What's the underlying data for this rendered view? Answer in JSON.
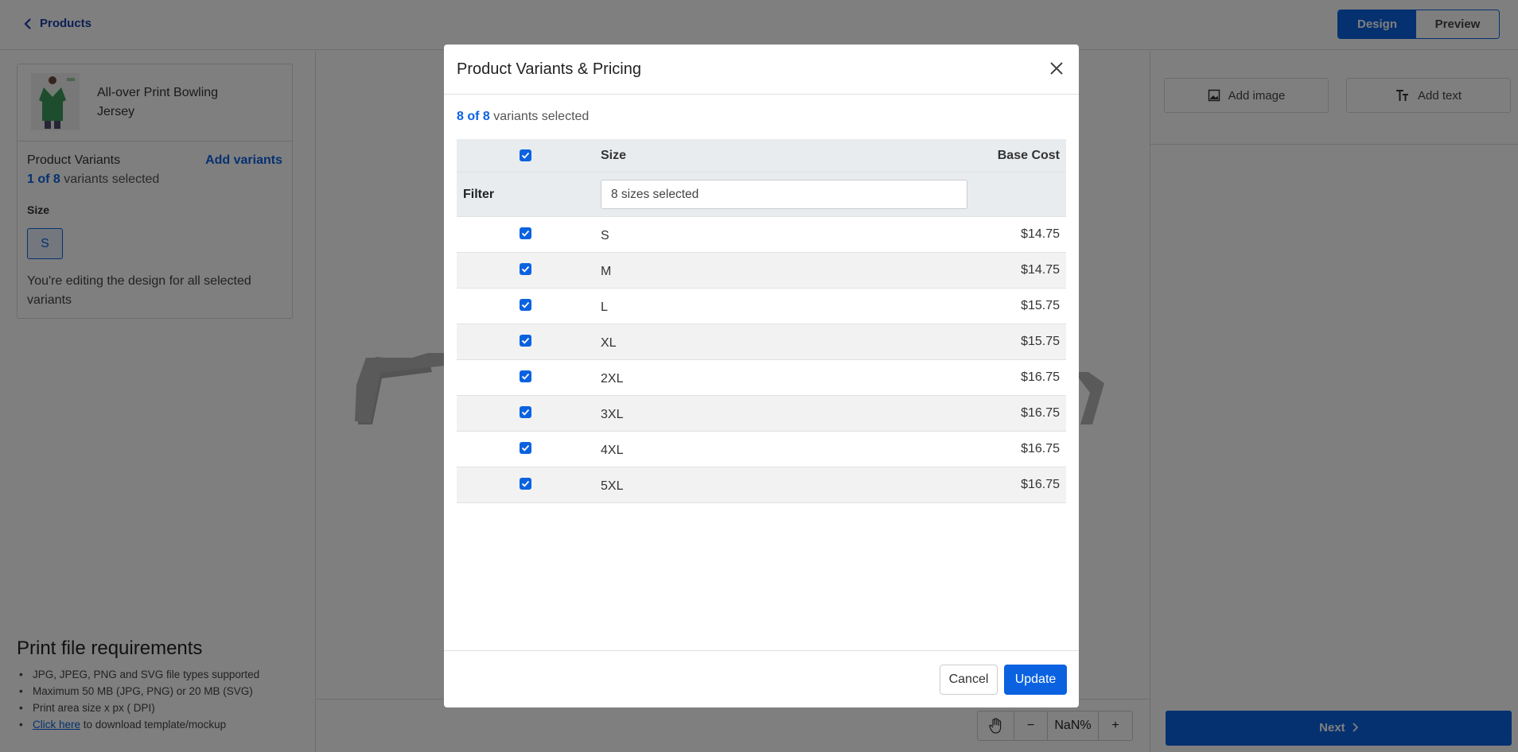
{
  "topbar": {
    "back_label": "Products",
    "tabs": [
      {
        "label": "Design",
        "active": true
      },
      {
        "label": "Preview",
        "active": false
      }
    ]
  },
  "sidebar": {
    "product_name": "All-over Print Bowling Jersey",
    "variants_label": "Product Variants",
    "add_variants_label": "Add variants",
    "selected_count": "1 of 8",
    "selected_suffix": "variants selected",
    "size_label": "Size",
    "selected_size": "S",
    "editing_note": "You're editing the design for all selected variants"
  },
  "print_requirements": {
    "title": "Print file requirements",
    "items": [
      "JPG, JPEG, PNG and SVG file types supported",
      "Maximum 50 MB (JPG, PNG) or 20 MB (SVG)",
      "Print area size x px ( DPI)"
    ],
    "link_text": "Click here",
    "link_suffix": " to download template/mockup"
  },
  "canvas": {
    "zoom_value": "NaN%"
  },
  "right_panel": {
    "add_image_label": "Add image",
    "add_text_label": "Add text",
    "next_label": "Next"
  },
  "modal": {
    "title": "Product Variants & Pricing",
    "selected_count": "8 of 8",
    "selected_suffix": "variants selected",
    "columns": {
      "size": "Size",
      "cost": "Base Cost"
    },
    "filter_label": "Filter",
    "filter_value": "8 sizes selected",
    "rows": [
      {
        "size": "S",
        "cost": "$14.75",
        "checked": true
      },
      {
        "size": "M",
        "cost": "$14.75",
        "checked": true
      },
      {
        "size": "L",
        "cost": "$15.75",
        "checked": true
      },
      {
        "size": "XL",
        "cost": "$15.75",
        "checked": true
      },
      {
        "size": "2XL",
        "cost": "$16.75",
        "checked": true
      },
      {
        "size": "3XL",
        "cost": "$16.75",
        "checked": true
      },
      {
        "size": "4XL",
        "cost": "$16.75",
        "checked": true
      },
      {
        "size": "5XL",
        "cost": "$16.75",
        "checked": true
      }
    ],
    "cancel_label": "Cancel",
    "update_label": "Update"
  },
  "colors": {
    "accent": "#0b62e0",
    "overlay": "rgba(0,0,0,0.5)"
  }
}
